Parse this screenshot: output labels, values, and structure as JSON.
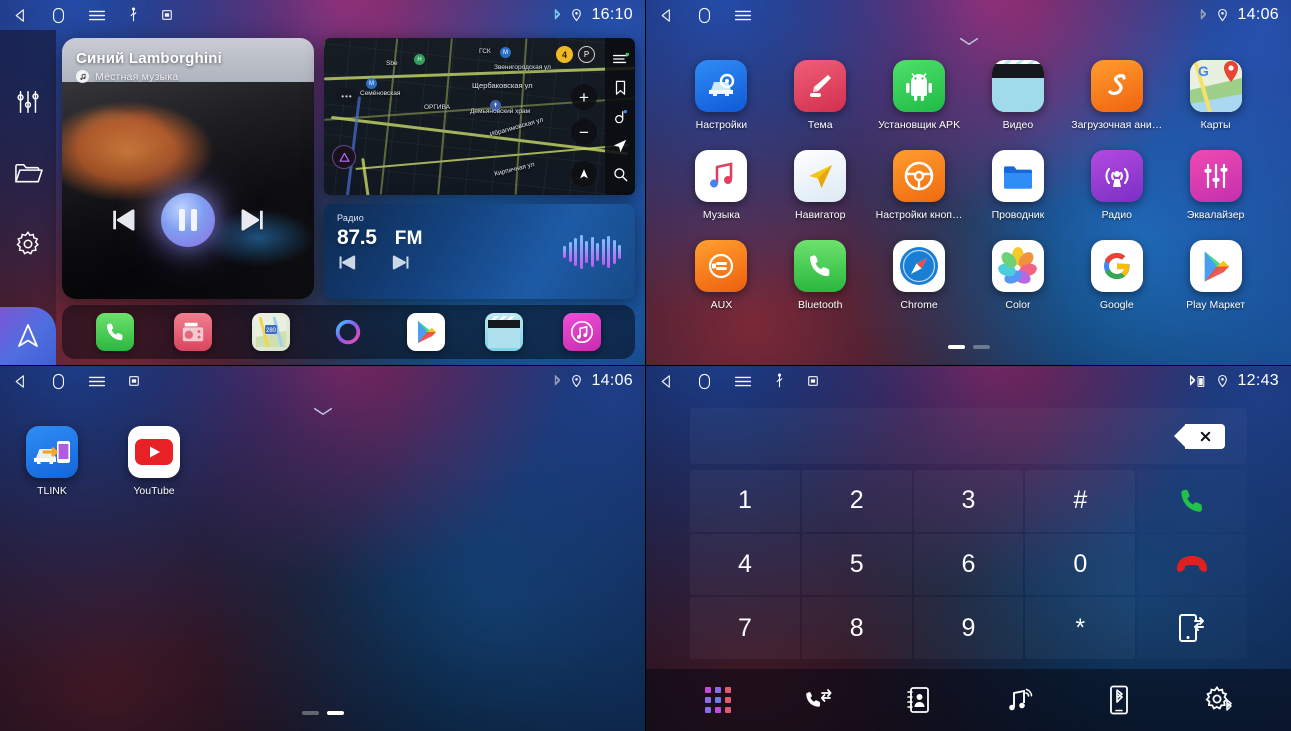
{
  "screens": {
    "media_home": {
      "status_bar": {
        "time": "16:10",
        "icons": [
          "back-icon",
          "home-icon",
          "menu-icon",
          "usb-icon",
          "sdcard-icon",
          "bluetooth-icon",
          "location-icon"
        ]
      },
      "sidebar": [
        {
          "name": "equalizer",
          "icon": "equalizer-sliders-icon"
        },
        {
          "name": "files",
          "icon": "folder-icon"
        },
        {
          "name": "settings",
          "icon": "gear-icon"
        }
      ],
      "nav_button": {
        "icon": "navigation-arrow-icon"
      },
      "media": {
        "title": "Синий Lamborghini",
        "subtitle": "Местная музыка",
        "source_badge_icon": "music-note-icon",
        "controls": [
          "previous-track",
          "pause",
          "next-track"
        ],
        "state": "playing"
      },
      "map": {
        "provider_icons": [
          "menu-icon",
          "bookmark-icon",
          "disc-icon",
          "navigate-icon",
          "search-icon"
        ],
        "traffic_level": "4",
        "parking_badge": "P",
        "zoom_in": "+",
        "zoom_out": "−",
        "streets": [
          "Звенигородская ул",
          "Щербаковская ул",
          "Семёновская",
          "Ибрагимовская ул",
          "Кирпичная ул",
          "ГСК",
          "Демьяновский храм",
          "ОРГИВА",
          "Sbe"
        ]
      },
      "radio": {
        "label": "Радио",
        "frequency": "87.5",
        "band": "FM",
        "prev_icon": "skip-back-icon",
        "next_icon": "skip-forward-icon",
        "visualizer_icon": "audio-waveform-icon",
        "bars": [
          12,
          20,
          28,
          34,
          22,
          30,
          18,
          26,
          32,
          24,
          14
        ]
      },
      "dock": [
        {
          "name": "phone",
          "icon": "phone-icon"
        },
        {
          "name": "radio",
          "icon": "radio-tuner-icon"
        },
        {
          "name": "maps",
          "icon": "maps-icon"
        },
        {
          "name": "assistant",
          "icon": "assistant-ring-icon"
        },
        {
          "name": "play-store",
          "icon": "play-store-icon"
        },
        {
          "name": "video",
          "icon": "clapperboard-icon"
        },
        {
          "name": "music",
          "icon": "music-circle-icon"
        }
      ]
    },
    "app_drawer": {
      "status_bar": {
        "time": "14:06",
        "icons": [
          "back-icon",
          "home-icon",
          "menu-icon",
          "bluetooth-icon",
          "location-icon"
        ]
      },
      "pull_handle_icon": "chevron-down-icon",
      "apps": [
        {
          "label": "Настройки",
          "icon": "car-settings-icon"
        },
        {
          "label": "Тема",
          "icon": "theme-brush-icon"
        },
        {
          "label": "Установщик APK",
          "icon": "android-icon"
        },
        {
          "label": "Видео",
          "icon": "clapperboard-icon"
        },
        {
          "label": "Загрузочная ани…",
          "icon": "boot-animation-icon"
        },
        {
          "label": "Карты",
          "icon": "google-maps-icon"
        },
        {
          "label": "Музыка",
          "icon": "music-notes-icon"
        },
        {
          "label": "Навигатор",
          "icon": "navigator-arrow-icon"
        },
        {
          "label": "Настройки кноп…",
          "icon": "steering-wheel-icon"
        },
        {
          "label": "Проводник",
          "icon": "folder-blue-icon"
        },
        {
          "label": "Радио",
          "icon": "radio-broadcast-icon"
        },
        {
          "label": "Эквалайзер",
          "icon": "equalizer-icon"
        },
        {
          "label": "AUX",
          "icon": "aux-plug-icon"
        },
        {
          "label": "Bluetooth",
          "icon": "phone-green-icon"
        },
        {
          "label": "Chrome",
          "icon": "safari-compass-icon"
        },
        {
          "label": "Color",
          "icon": "color-flower-icon"
        },
        {
          "label": "Google",
          "icon": "google-g-icon"
        },
        {
          "label": "Play Маркет",
          "icon": "play-store-icon"
        }
      ],
      "page_dots": {
        "count": 2,
        "active": 0
      }
    },
    "home_page2": {
      "status_bar": {
        "time": "14:06",
        "icons": [
          "back-icon",
          "home-icon",
          "menu-icon",
          "sdcard-icon",
          "bluetooth-icon",
          "location-icon"
        ]
      },
      "pull_handle_icon": "chevron-down-icon",
      "apps": [
        {
          "label": "TLINK",
          "icon": "tlink-carplay-icon"
        },
        {
          "label": "YouTube",
          "icon": "youtube-icon"
        }
      ],
      "page_dots": {
        "count": 2,
        "active": 1
      }
    },
    "dialer": {
      "status_bar": {
        "time": "12:43",
        "icons": [
          "back-icon",
          "home-icon",
          "menu-icon",
          "usb-icon",
          "sdcard-icon",
          "bluetooth-battery-icon",
          "location-icon"
        ]
      },
      "input": {
        "value": "",
        "placeholder": ""
      },
      "delete_key": {
        "icon": "backspace-icon"
      },
      "keys": [
        {
          "label": "1",
          "type": "digit"
        },
        {
          "label": "2",
          "type": "digit"
        },
        {
          "label": "3",
          "type": "digit"
        },
        {
          "label": "#",
          "type": "symbol"
        },
        {
          "label": "",
          "type": "call",
          "icon": "call-green-icon"
        },
        {
          "label": "4",
          "type": "digit"
        },
        {
          "label": "5",
          "type": "digit"
        },
        {
          "label": "6",
          "type": "digit"
        },
        {
          "label": "0",
          "type": "digit"
        },
        {
          "label": "",
          "type": "hangup",
          "icon": "hangup-red-icon"
        },
        {
          "label": "7",
          "type": "digit"
        },
        {
          "label": "8",
          "type": "digit"
        },
        {
          "label": "9",
          "type": "digit"
        },
        {
          "label": "*",
          "type": "symbol"
        },
        {
          "label": "",
          "type": "transfer",
          "icon": "transfer-to-phone-icon"
        }
      ],
      "toolbar": [
        {
          "name": "keypad",
          "icon": "keypad-dots-icon"
        },
        {
          "name": "call-log",
          "icon": "call-history-icon"
        },
        {
          "name": "contacts",
          "icon": "contacts-book-icon"
        },
        {
          "name": "bt-music",
          "icon": "bluetooth-music-icon"
        },
        {
          "name": "bt-device",
          "icon": "bluetooth-phone-icon"
        },
        {
          "name": "bt-settings",
          "icon": "bluetooth-settings-icon"
        }
      ]
    }
  },
  "colors": {
    "accent_blue": "#3f7fe0",
    "accent_purple": "#8d6de0",
    "call_green": "#21c14a",
    "hangup_red": "#e02020",
    "radio_card": "#1d5ba6",
    "status_text": "#ffffff"
  }
}
